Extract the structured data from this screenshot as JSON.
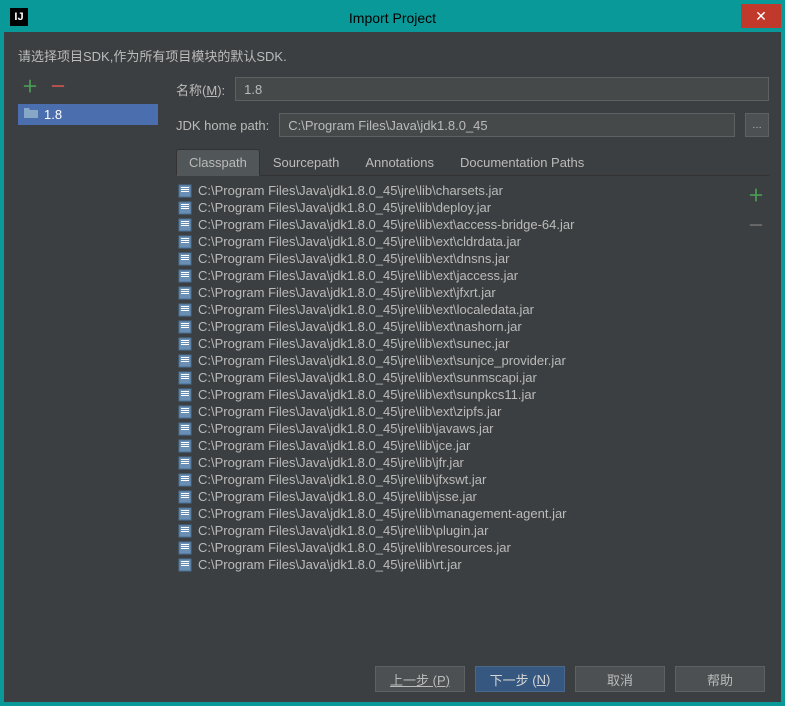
{
  "window": {
    "title": "Import Project"
  },
  "instruction": "请选择项目SDK,作为所有项目模块的默认SDK.",
  "sidebar": {
    "item": "1.8"
  },
  "form": {
    "nameLabelPrefix": "名称(",
    "nameLabelAccel": "M",
    "nameLabelSuffix": "):",
    "nameValue": "1.8",
    "homeLabel": "JDK home path:",
    "homeValue": "C:\\Program Files\\Java\\jdk1.8.0_45"
  },
  "tabs": {
    "items": [
      "Classpath",
      "Sourcepath",
      "Annotations",
      "Documentation Paths"
    ],
    "active": 0
  },
  "classpath": [
    "C:\\Program Files\\Java\\jdk1.8.0_45\\jre\\lib\\charsets.jar",
    "C:\\Program Files\\Java\\jdk1.8.0_45\\jre\\lib\\deploy.jar",
    "C:\\Program Files\\Java\\jdk1.8.0_45\\jre\\lib\\ext\\access-bridge-64.jar",
    "C:\\Program Files\\Java\\jdk1.8.0_45\\jre\\lib\\ext\\cldrdata.jar",
    "C:\\Program Files\\Java\\jdk1.8.0_45\\jre\\lib\\ext\\dnsns.jar",
    "C:\\Program Files\\Java\\jdk1.8.0_45\\jre\\lib\\ext\\jaccess.jar",
    "C:\\Program Files\\Java\\jdk1.8.0_45\\jre\\lib\\ext\\jfxrt.jar",
    "C:\\Program Files\\Java\\jdk1.8.0_45\\jre\\lib\\ext\\localedata.jar",
    "C:\\Program Files\\Java\\jdk1.8.0_45\\jre\\lib\\ext\\nashorn.jar",
    "C:\\Program Files\\Java\\jdk1.8.0_45\\jre\\lib\\ext\\sunec.jar",
    "C:\\Program Files\\Java\\jdk1.8.0_45\\jre\\lib\\ext\\sunjce_provider.jar",
    "C:\\Program Files\\Java\\jdk1.8.0_45\\jre\\lib\\ext\\sunmscapi.jar",
    "C:\\Program Files\\Java\\jdk1.8.0_45\\jre\\lib\\ext\\sunpkcs11.jar",
    "C:\\Program Files\\Java\\jdk1.8.0_45\\jre\\lib\\ext\\zipfs.jar",
    "C:\\Program Files\\Java\\jdk1.8.0_45\\jre\\lib\\javaws.jar",
    "C:\\Program Files\\Java\\jdk1.8.0_45\\jre\\lib\\jce.jar",
    "C:\\Program Files\\Java\\jdk1.8.0_45\\jre\\lib\\jfr.jar",
    "C:\\Program Files\\Java\\jdk1.8.0_45\\jre\\lib\\jfxswt.jar",
    "C:\\Program Files\\Java\\jdk1.8.0_45\\jre\\lib\\jsse.jar",
    "C:\\Program Files\\Java\\jdk1.8.0_45\\jre\\lib\\management-agent.jar",
    "C:\\Program Files\\Java\\jdk1.8.0_45\\jre\\lib\\plugin.jar",
    "C:\\Program Files\\Java\\jdk1.8.0_45\\jre\\lib\\resources.jar",
    "C:\\Program Files\\Java\\jdk1.8.0_45\\jre\\lib\\rt.jar"
  ],
  "buttons": {
    "prev": "上一步 (P)",
    "nextPrefix": "下一步 (",
    "nextAccel": "N",
    "nextSuffix": ")",
    "cancel": "取消",
    "help": "帮助"
  }
}
